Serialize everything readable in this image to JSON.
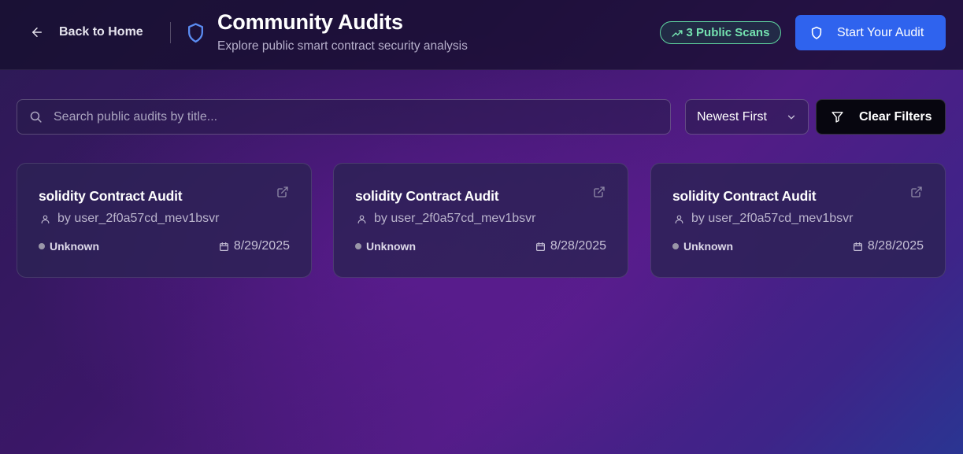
{
  "header": {
    "back_label": "Back to Home",
    "title": "Community Audits",
    "subtitle": "Explore public smart contract security analysis",
    "badge_label": "3 Public Scans",
    "cta_label": "Start Your Audit"
  },
  "toolbar": {
    "search_placeholder": "Search public audits by title...",
    "search_value": "",
    "sort_selected": "Newest First",
    "clear_label": "Clear Filters"
  },
  "audits": [
    {
      "title": "solidity Contract Audit",
      "author": "by user_2f0a57cd_mev1bsvr",
      "status": "Unknown",
      "date": "8/29/2025"
    },
    {
      "title": "solidity Contract Audit",
      "author": "by user_2f0a57cd_mev1bsvr",
      "status": "Unknown",
      "date": "8/28/2025"
    },
    {
      "title": "solidity Contract Audit",
      "author": "by user_2f0a57cd_mev1bsvr",
      "status": "Unknown",
      "date": "8/28/2025"
    }
  ],
  "icons": {
    "back": "arrow-left-icon",
    "logo": "shield-icon",
    "badge": "trending-up-icon",
    "cta": "shield-icon",
    "search": "search-icon",
    "sort": "chevron-down-icon",
    "clear": "filter-icon",
    "card_open": "external-link-icon",
    "author": "user-icon",
    "date": "calendar-icon"
  },
  "colors": {
    "accent_blue": "#2f63ee",
    "badge_green": "#74e2b0",
    "status_unknown": "#9a96a8",
    "logo_blue": "#5b8cf2"
  }
}
